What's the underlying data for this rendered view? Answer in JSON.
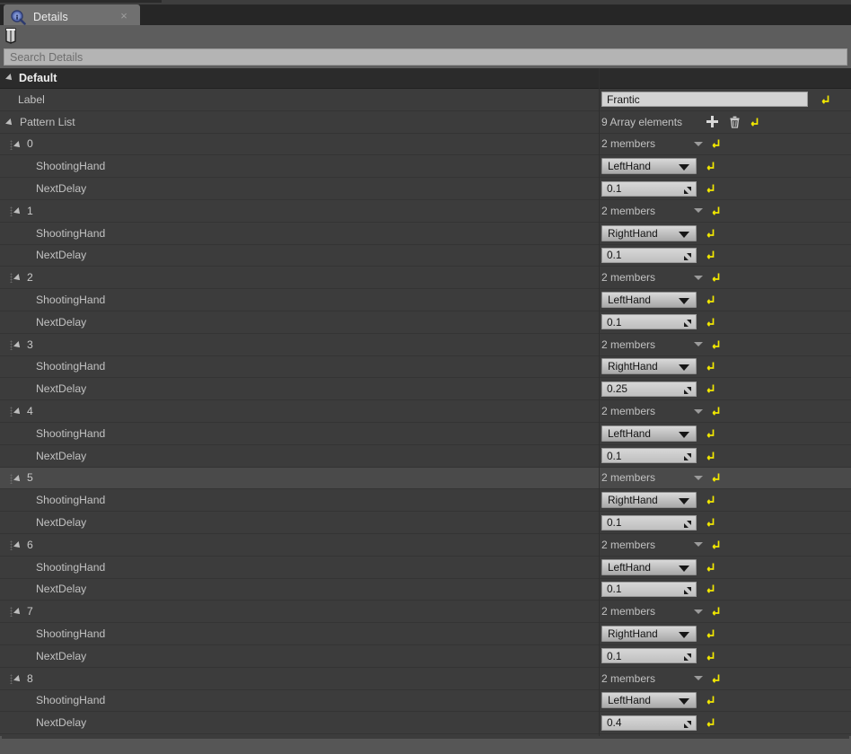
{
  "window": {
    "tab_title": "Details",
    "tab_icon": "details-info-magnifier-icon",
    "close_icon": "×"
  },
  "toolbar": {
    "filter_icon": "column-filter-icon"
  },
  "search": {
    "placeholder": "Search Details",
    "value": ""
  },
  "category": {
    "label": "Default",
    "expanded": true
  },
  "colors": {
    "panel_bg": "#3c3c3c",
    "row_highlight": "#4a4a4a",
    "category_bg": "#2b2b2b",
    "toolbar_bg": "#5d5d5d",
    "tab_bg": "#707070",
    "reset_arrow": "#f2e800",
    "field_bg": "#d3d3d3",
    "text": "#c2c2c2"
  },
  "properties": {
    "label_row": {
      "name": "Label",
      "value": "Frantic",
      "reset_tooltip": "reset-to-default"
    },
    "pattern_list": {
      "name": "Pattern List",
      "expanded": true,
      "array_summary": "9 Array elements",
      "add_label": "add-element",
      "delete_label": "delete-all-elements"
    }
  },
  "member_labels": {
    "shooting_hand": "ShootingHand",
    "next_delay": "NextDelay",
    "members_summary": "2 members"
  },
  "pattern_elements": [
    {
      "index": "0",
      "members": "2 members",
      "shooting_hand": "LeftHand",
      "next_delay": "0.1",
      "highlighted": false
    },
    {
      "index": "1",
      "members": "2 members",
      "shooting_hand": "RightHand",
      "next_delay": "0.1",
      "highlighted": false
    },
    {
      "index": "2",
      "members": "2 members",
      "shooting_hand": "LeftHand",
      "next_delay": "0.1",
      "highlighted": false
    },
    {
      "index": "3",
      "members": "2 members",
      "shooting_hand": "RightHand",
      "next_delay": "0.25",
      "highlighted": false
    },
    {
      "index": "4",
      "members": "2 members",
      "shooting_hand": "LeftHand",
      "next_delay": "0.1",
      "highlighted": false
    },
    {
      "index": "5",
      "members": "2 members",
      "shooting_hand": "RightHand",
      "next_delay": "0.1",
      "highlighted": true
    },
    {
      "index": "6",
      "members": "2 members",
      "shooting_hand": "LeftHand",
      "next_delay": "0.1",
      "highlighted": false
    },
    {
      "index": "7",
      "members": "2 members",
      "shooting_hand": "RightHand",
      "next_delay": "0.1",
      "highlighted": false
    },
    {
      "index": "8",
      "members": "2 members",
      "shooting_hand": "LeftHand",
      "next_delay": "0.4",
      "highlighted": false
    }
  ]
}
